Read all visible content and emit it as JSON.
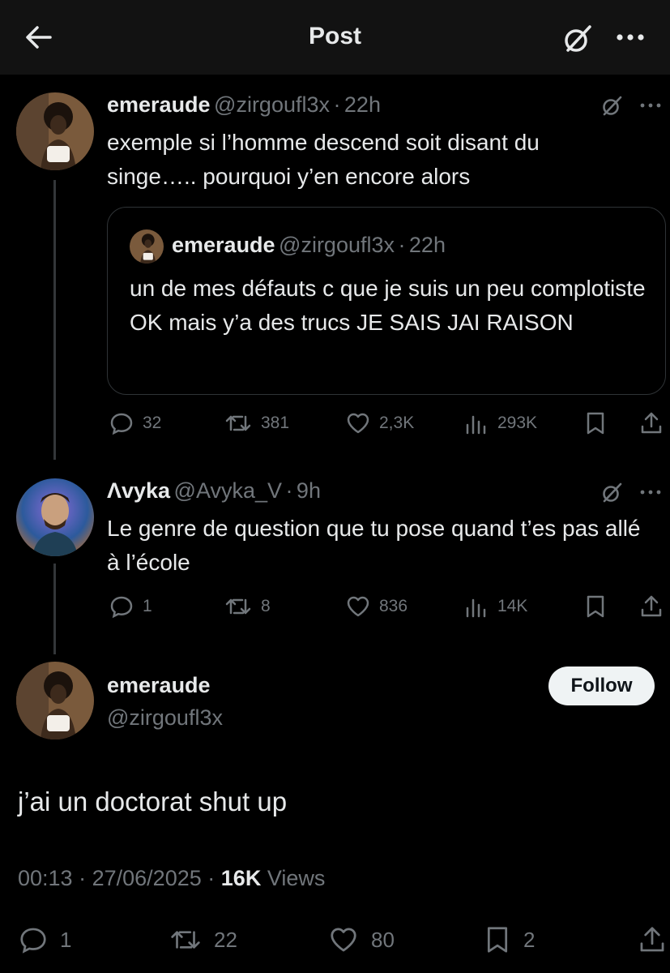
{
  "header": {
    "title": "Post",
    "back_icon": "arrow-left-icon",
    "grok_icon": "grok-icon",
    "more_icon": "more-icon"
  },
  "tweets": [
    {
      "name": "emeraude",
      "handle": "@zirgoufl3x",
      "time": "22h",
      "text": "exemple si l’homme descend soit disant du singe….. pourquoi y’en encore alors",
      "quote": {
        "name": "emeraude",
        "handle": "@zirgoufl3x",
        "time": "22h",
        "text": "un de mes défauts c que je suis un peu complotiste OK mais y’a des trucs JE SAIS JAI RAISON"
      },
      "stats": {
        "replies": "32",
        "reposts": "381",
        "likes": "2,3K",
        "views": "293K"
      }
    },
    {
      "name": "Λvyka",
      "handle": "@Avyka_V",
      "time": "9h",
      "text": "Le genre de question que tu pose quand t’es pas allé à l’école",
      "stats": {
        "replies": "1",
        "reposts": "8",
        "likes": "836",
        "views": "14K"
      }
    }
  ],
  "main_post": {
    "name": "emeraude",
    "handle": "@zirgoufl3x",
    "follow_label": "Follow",
    "text": "j’ai un doctorat shut up",
    "time": "00:13",
    "date": "27/06/2025",
    "views_count": "16K",
    "views_label": "Views",
    "stats": {
      "replies": "1",
      "reposts": "22",
      "likes": "80",
      "bookmarks": "2"
    }
  },
  "separator": "·",
  "colors": {
    "background": "#000000",
    "text": "#e7e9ea",
    "muted": "#71767b",
    "border": "#2f3336",
    "follow_bg": "#eff3f4"
  }
}
